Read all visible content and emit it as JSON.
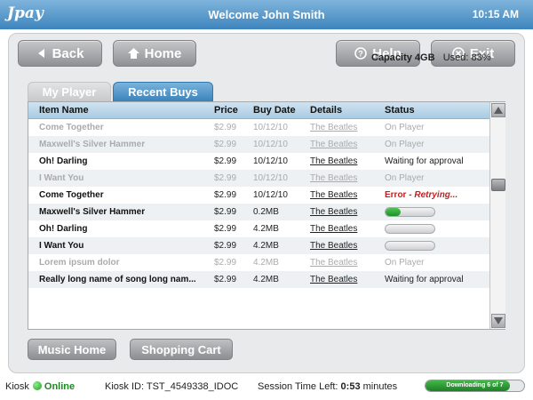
{
  "header": {
    "logo": "Jpay",
    "welcome": "Welcome John Smith",
    "time": "10:15 AM"
  },
  "nav": {
    "back": "Back",
    "home": "Home",
    "help": "Help",
    "exit": "Exit"
  },
  "tabs": [
    {
      "label": "My Player",
      "active": false
    },
    {
      "label": "Recent Buys",
      "active": true
    }
  ],
  "capacity": {
    "label": "Capacity 4GB",
    "used": "Used: 83%"
  },
  "table": {
    "columns": [
      "Item Name",
      "Price",
      "Buy Date",
      "Details",
      "Status"
    ],
    "rows": [
      {
        "name": "Come Together",
        "price": "$2.99",
        "date": "10/12/10",
        "details": "The Beatles",
        "status": "On Player",
        "dim": true
      },
      {
        "name": "Maxwell's Silver Hammer",
        "price": "$2.99",
        "date": "10/12/10",
        "details": "The Beatles",
        "status": "On Player",
        "dim": true
      },
      {
        "name": "Oh! Darling",
        "price": "$2.99",
        "date": "10/12/10",
        "details": "The Beatles",
        "status": "Waiting for approval",
        "dim": false
      },
      {
        "name": "I Want You",
        "price": "$2.99",
        "date": "10/12/10",
        "details": "The Beatles",
        "status": "On Player",
        "dim": true
      },
      {
        "name": "Come Together",
        "price": "$2.99",
        "date": "10/12/10",
        "details": "The Beatles",
        "status_error": "Error - ",
        "status_retry": "Retrying...",
        "dim": false
      },
      {
        "name": "Maxwell's Silver Hammer",
        "price": "$2.99",
        "date": "0.2MB",
        "details": "The Beatles",
        "progress": 0.3,
        "dim": false
      },
      {
        "name": "Oh! Darling",
        "price": "$2.99",
        "date": "4.2MB",
        "details": "The Beatles",
        "progress": 0,
        "dim": false
      },
      {
        "name": "I Want You",
        "price": "$2.99",
        "date": "4.2MB",
        "details": "The Beatles",
        "progress": 0,
        "dim": false
      },
      {
        "name": "Lorem ipsum dolor",
        "price": "$2.99",
        "date": "4.2MB",
        "details": "The Beatles",
        "status": "On Player",
        "dim": true
      },
      {
        "name": "Really long name of song long nam...",
        "price": "$2.99",
        "date": "4.2MB",
        "details": "The Beatles",
        "status": "Waiting for approval",
        "dim": false
      }
    ]
  },
  "bottom_nav": {
    "music_home": "Music Home",
    "shopping_cart": "Shopping Cart"
  },
  "status_bar": {
    "kiosk_label": "Kiosk",
    "online": "Online",
    "kiosk_id": "Kiosk ID: TST_4549338_IDOC",
    "session_label": "Session Time Left: ",
    "session_time": "0:53",
    "session_unit": " minutes",
    "download_text": "Downloading 6 of 7",
    "download_progress": 0.86
  },
  "colors": {
    "accent": "#3d85bd",
    "online": "#1b8a20",
    "error": "#c61f1f",
    "progress": "#2aa533"
  }
}
